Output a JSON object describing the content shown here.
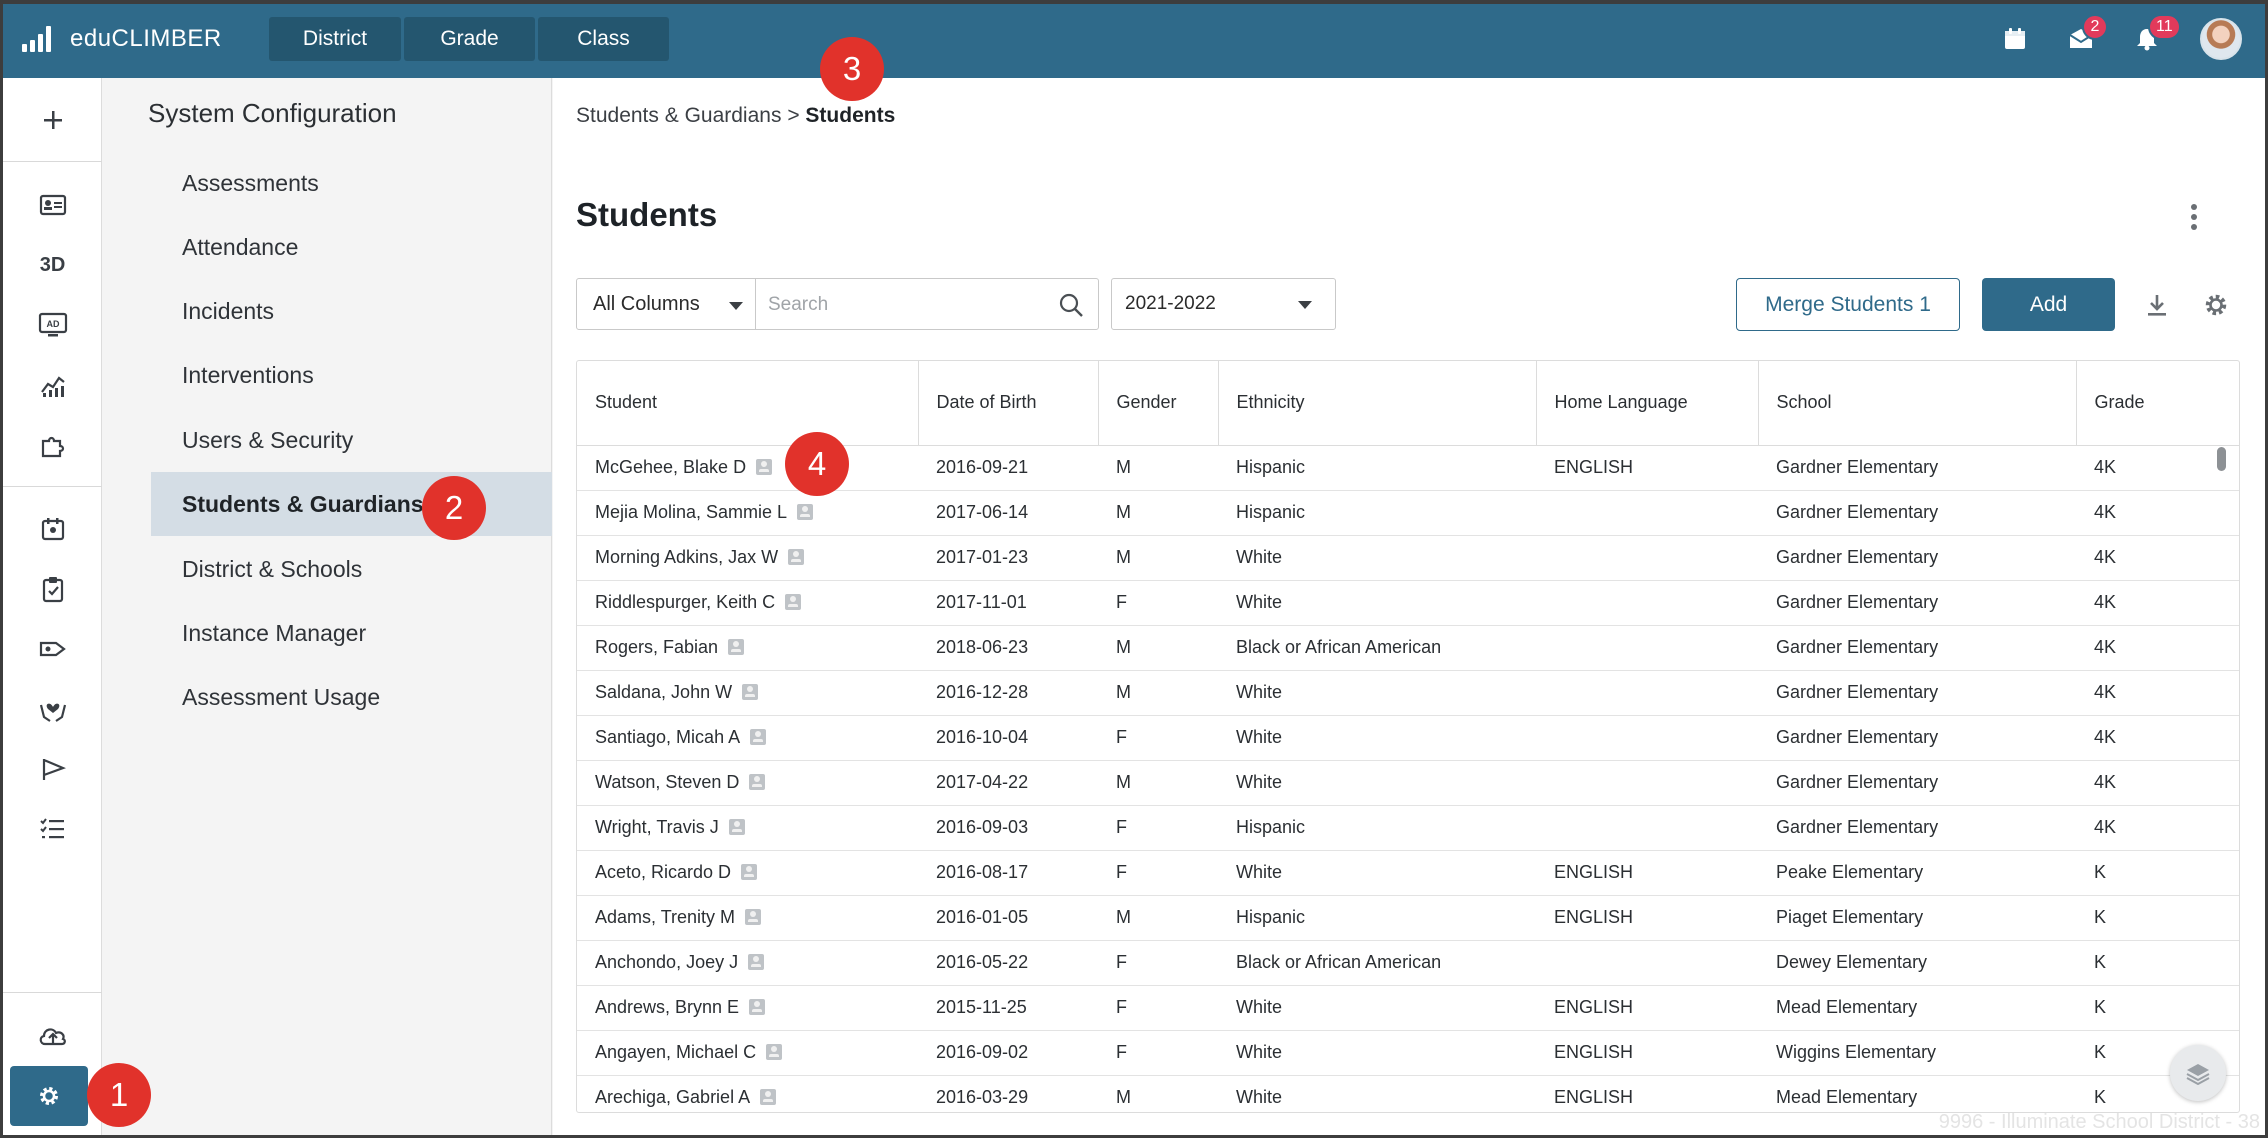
{
  "app": {
    "name": "eduCLIMBER"
  },
  "top_nav": {
    "tabs": [
      "District",
      "Grade",
      "Class"
    ]
  },
  "notifications": {
    "mail_count": "2",
    "bell_count": "11"
  },
  "rail": {
    "icons": [
      "add-icon",
      "student-card-icon",
      "3d-label",
      "ad-screen-icon",
      "chart-icon",
      "puzzle-icon",
      "calendar-icon",
      "clipboard-icon",
      "tag-icon",
      "hands-heart-icon",
      "flag-icon",
      "checklist-icon",
      "cloud-upload-icon",
      "settings-gear-icon"
    ],
    "label_3d": "3D",
    "ad_label": "AD"
  },
  "subnav": {
    "title": "System Configuration",
    "items": [
      {
        "label": "Assessments"
      },
      {
        "label": "Attendance"
      },
      {
        "label": "Incidents"
      },
      {
        "label": "Interventions"
      },
      {
        "label": "Users & Security"
      },
      {
        "label": "Students & Guardians"
      },
      {
        "label": "District & Schools"
      },
      {
        "label": "Instance Manager"
      },
      {
        "label": "Assessment Usage"
      }
    ],
    "active_index": 5
  },
  "breadcrumb": {
    "parent": "Students & Guardians",
    "sep": ">",
    "current": "Students"
  },
  "page": {
    "title": "Students"
  },
  "toolbar": {
    "column_select": "All Columns",
    "search_placeholder": "Search",
    "year_select": "2021-2022",
    "merge_label": "Merge Students 1",
    "add_label": "Add"
  },
  "table": {
    "columns": [
      "Student",
      "Date of Birth",
      "Gender",
      "Ethnicity",
      "Home Language",
      "School",
      "Grade"
    ],
    "rows": [
      [
        "McGehee, Blake D",
        "2016-09-21",
        "M",
        "Hispanic",
        "ENGLISH",
        "Gardner Elementary",
        "4K"
      ],
      [
        "Mejia Molina, Sammie L",
        "2017-06-14",
        "M",
        "Hispanic",
        "",
        "Gardner Elementary",
        "4K"
      ],
      [
        "Morning Adkins, Jax W",
        "2017-01-23",
        "M",
        "White",
        "",
        "Gardner Elementary",
        "4K"
      ],
      [
        "Riddlespurger, Keith C",
        "2017-11-01",
        "F",
        "White",
        "",
        "Gardner Elementary",
        "4K"
      ],
      [
        "Rogers, Fabian",
        "2018-06-23",
        "M",
        "Black or African American",
        "",
        "Gardner Elementary",
        "4K"
      ],
      [
        "Saldana, John W",
        "2016-12-28",
        "M",
        "White",
        "",
        "Gardner Elementary",
        "4K"
      ],
      [
        "Santiago, Micah A",
        "2016-10-04",
        "F",
        "White",
        "",
        "Gardner Elementary",
        "4K"
      ],
      [
        "Watson, Steven D",
        "2017-04-22",
        "M",
        "White",
        "",
        "Gardner Elementary",
        "4K"
      ],
      [
        "Wright, Travis J",
        "2016-09-03",
        "F",
        "Hispanic",
        "",
        "Gardner Elementary",
        "4K"
      ],
      [
        "Aceto, Ricardo D",
        "2016-08-17",
        "F",
        "White",
        "ENGLISH",
        "Peake Elementary",
        "K"
      ],
      [
        "Adams, Trenity M",
        "2016-01-05",
        "M",
        "Hispanic",
        "ENGLISH",
        "Piaget Elementary",
        "K"
      ],
      [
        "Anchondo, Joey J",
        "2016-05-22",
        "F",
        "Black or African American",
        "",
        "Dewey Elementary",
        "K"
      ],
      [
        "Andrews, Brynn E",
        "2015-11-25",
        "F",
        "White",
        "ENGLISH",
        "Mead Elementary",
        "K"
      ],
      [
        "Angayen, Michael C",
        "2016-09-02",
        "F",
        "White",
        "ENGLISH",
        "Wiggins Elementary",
        "K"
      ],
      [
        "Arechiga, Gabriel A",
        "2016-03-29",
        "M",
        "White",
        "ENGLISH",
        "Mead Elementary",
        "K"
      ]
    ]
  },
  "footer": {
    "watermark": "9996 - Illuminate School District - 38"
  },
  "callouts": [
    "1",
    "2",
    "3",
    "4"
  ],
  "colors": {
    "primary": "#2f6a8a",
    "callout": "#e1322b",
    "badge": "#e23a5b"
  }
}
